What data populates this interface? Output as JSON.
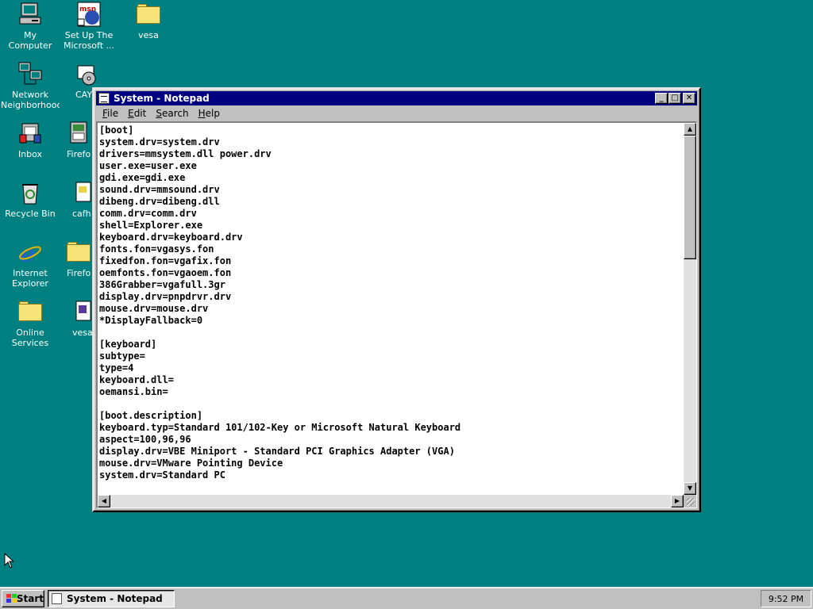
{
  "desktop": {
    "background_color": "#008080",
    "icons": [
      {
        "label": "My Computer",
        "icon": "computer-icon"
      },
      {
        "label": "Set Up The\nMicrosoft ...",
        "icon": "msn-setup-icon"
      },
      {
        "label": "vesa",
        "icon": "folder-icon"
      },
      {
        "label": "Network\nNeighborhood",
        "icon": "network-icon"
      },
      {
        "label": "CAY7v",
        "icon": "setup-disc-icon"
      },
      {
        "label": "Inbox",
        "icon": "inbox-icon"
      },
      {
        "label": "Firefox\n1_5_",
        "icon": "installer-icon"
      },
      {
        "label": "Recycle Bin",
        "icon": "recycle-bin-icon"
      },
      {
        "label": "cafh",
        "icon": "file-icon"
      },
      {
        "label": "Internet\nExplorer",
        "icon": "internet-explorer-icon"
      },
      {
        "label": "Firefox\n1_5_",
        "icon": "folder-icon"
      },
      {
        "label": "Online\nServices",
        "icon": "folder-icon"
      },
      {
        "label": "vesa",
        "icon": "file-icon"
      }
    ]
  },
  "window": {
    "title": "System - Notepad",
    "menus": [
      {
        "underline": "F",
        "rest": "ile"
      },
      {
        "underline": "E",
        "rest": "dit"
      },
      {
        "underline": "S",
        "rest": "earch"
      },
      {
        "underline": "H",
        "rest": "elp"
      }
    ],
    "buttons": {
      "minimize": "_",
      "maximize": "□",
      "close": "✕"
    },
    "lines": [
      "[boot]",
      "system.drv=system.drv",
      "drivers=mmsystem.dll power.drv",
      "user.exe=user.exe",
      "gdi.exe=gdi.exe",
      "sound.drv=mmsound.drv",
      "dibeng.drv=dibeng.dll",
      "comm.drv=comm.drv",
      "shell=Explorer.exe",
      "keyboard.drv=keyboard.drv",
      "fonts.fon=vgasys.fon",
      "fixedfon.fon=vgafix.fon",
      "oemfonts.fon=vgaoem.fon",
      "386Grabber=vgafull.3gr",
      "display.drv=pnpdrvr.drv",
      "mouse.drv=mouse.drv",
      "*DisplayFallback=0",
      "",
      "[keyboard]",
      "subtype=",
      "type=4",
      "keyboard.dll=",
      "oemansi.bin=",
      "",
      "[boot.description]",
      "keyboard.typ=Standard 101/102-Key or Microsoft Natural Keyboard",
      "aspect=100,96,96",
      "display.drv=VBE Miniport - Standard PCI Graphics Adapter (VGA)",
      "mouse.drv=VMware Pointing Device",
      "system.drv=Standard PC"
    ]
  },
  "taskbar": {
    "start_label": "Start",
    "task_label": "System - Notepad",
    "clock": "9:52 PM"
  },
  "colors": {
    "titlebar": "#000080",
    "face": "#c0c0c0"
  }
}
